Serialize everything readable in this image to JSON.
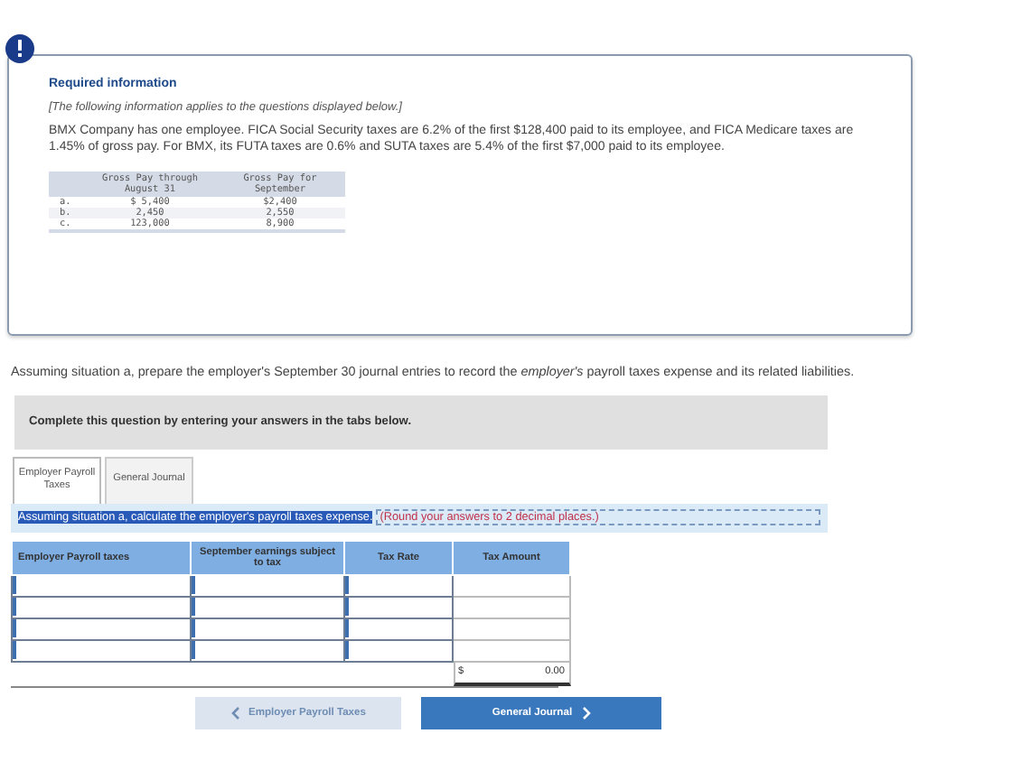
{
  "info": {
    "title": "Required information",
    "note": "[The following information applies to the questions displayed below.]",
    "paragraph": "BMX Company has one employee. FICA Social Security taxes are 6.2% of the first $128,400 paid to its employee, and FICA Medicare taxes are 1.45% of gross pay. For BMX, its FUTA taxes are 0.6% and SUTA taxes are 5.4% of the first $7,000 paid to its employee.",
    "data_table": {
      "columns": [
        "Gross Pay through August 31",
        "Gross Pay for September"
      ],
      "rows": [
        {
          "label": "a.",
          "cells": [
            "$  5,400",
            "$2,400"
          ]
        },
        {
          "label": "b.",
          "cells": [
            "2,450",
            "2,550"
          ]
        },
        {
          "label": "c.",
          "cells": [
            "123,000",
            "8,900"
          ]
        }
      ]
    }
  },
  "question": "Assuming situation a, prepare the employer's September 30 journal entries to record the *employer's* payroll taxes expense and its related liabilities.",
  "instruction": "Complete this question by entering your answers in the tabs below.",
  "tabs": [
    {
      "label": "Employer Payroll Taxes",
      "selected": true
    },
    {
      "label": "General Journal",
      "selected": false
    }
  ],
  "prompt": {
    "highlighted": "Assuming situation a, calculate the employer's payroll taxes expense.",
    "hint": "(Round your answers to 2 decimal places.)"
  },
  "answer_table": {
    "columns": [
      "Employer Payroll taxes",
      "September earnings subject to tax",
      "Tax Rate",
      "Tax Amount"
    ],
    "rows": [
      {
        "kind": "input"
      },
      {
        "kind": "input"
      },
      {
        "kind": "input"
      },
      {
        "kind": "input"
      }
    ],
    "total_currency": "$",
    "total": "0.00"
  },
  "buttons": [
    {
      "label": "Employer Payroll Taxes",
      "kind": "back",
      "disabled": true
    },
    {
      "label": "General Journal",
      "kind": "forward",
      "disabled": false
    }
  ]
}
